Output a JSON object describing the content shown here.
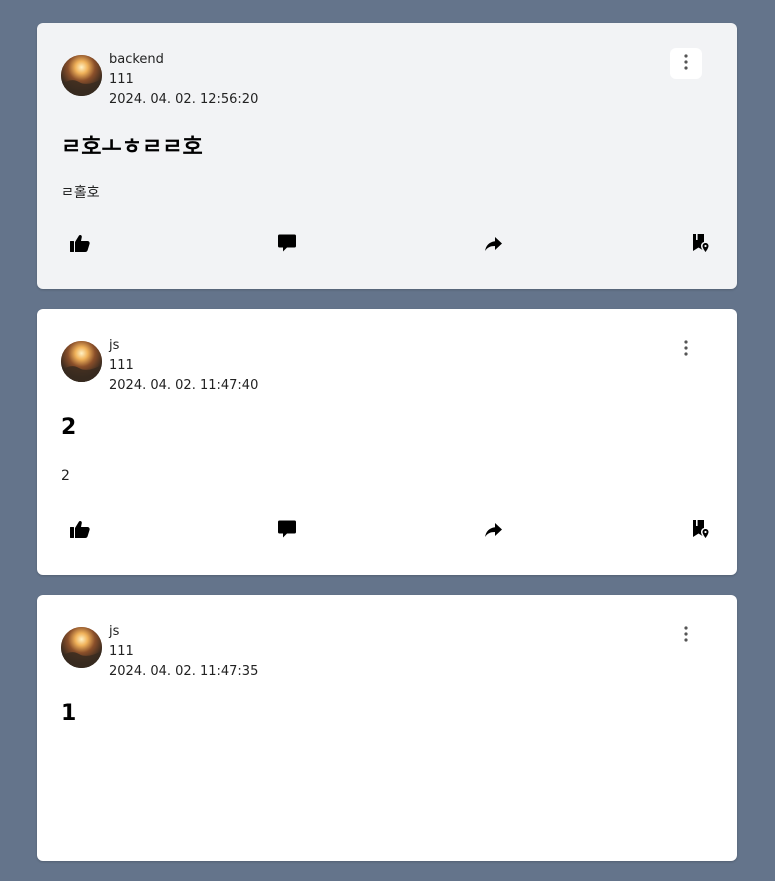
{
  "posts": [
    {
      "author": "backend",
      "subline": "111",
      "timestamp": "2024. 04. 02. 12:56:20",
      "title": "ㄹ호ㅗㅎㄹㄹ호",
      "body": "ㄹ홀호",
      "highlighted": true
    },
    {
      "author": "js",
      "subline": "111",
      "timestamp": "2024. 04. 02. 11:47:40",
      "title": "2",
      "body": "2",
      "highlighted": false
    },
    {
      "author": "js",
      "subline": "111",
      "timestamp": "2024. 04. 02. 11:47:35",
      "title": "1",
      "body": "",
      "highlighted": false
    }
  ],
  "icons": {
    "like": "thumbs-up-icon",
    "comment": "comment-icon",
    "share": "share-arrow-icon",
    "save": "bookmark-location-icon",
    "menu": "more-vertical-icon"
  },
  "colors": {
    "background": "#64748b",
    "card": "#ffffff",
    "card_highlight": "#f2f3f5"
  }
}
